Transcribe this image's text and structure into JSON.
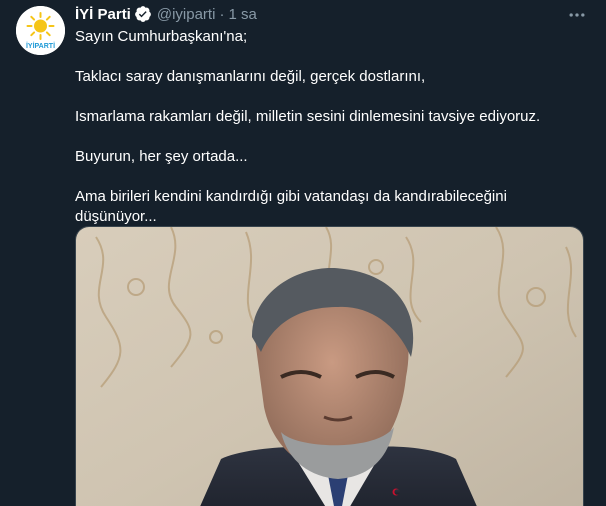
{
  "author": {
    "name": "İYİ Parti",
    "handle": "@iyiparti",
    "separator": "·",
    "time": "1 sa",
    "avatar_text": "İYİPARTİ",
    "verified_icon": "verified-badge-icon"
  },
  "more_icon": "more-options-icon",
  "tweet": {
    "line1": "Sayın Cumhurbaşkanı'na;",
    "line2": "Taklacı saray danışmanlarını değil, gerçek dostlarını,",
    "line3": "Ismarlama rakamları değil, milletin sesini dinlemesini tavsiye ediyoruz.",
    "line4": "Buyurun, her şey ortada...",
    "line5": "Ama birileri kendini kandırdığı gibi vatandaşı da kandırabileceğini düşünüyor..."
  },
  "colors": {
    "background": "#15202b",
    "secondary_text": "#8899a6",
    "verified": "#ffffff",
    "brand": "#1f9ad6",
    "brand_sun": "#f5c518"
  }
}
